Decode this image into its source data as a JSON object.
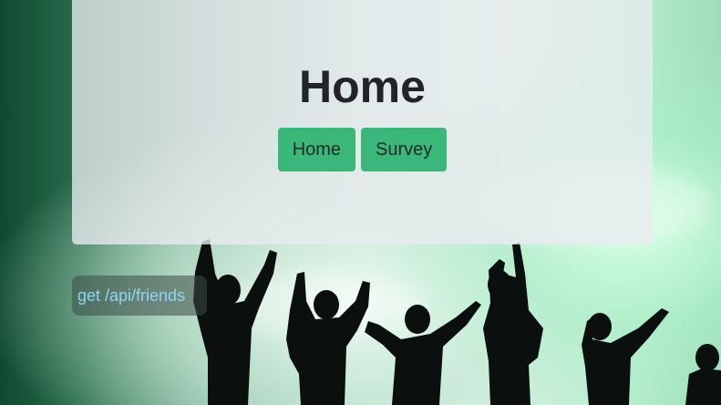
{
  "jumbotron": {
    "title": "Home"
  },
  "nav": {
    "home_label": "Home",
    "survey_label": "Survey"
  },
  "api_label": "get /api/friends",
  "colors": {
    "button_bg": "#3ab879",
    "button_text": "#1e2a24",
    "title_text": "#212529",
    "api_text": "#8fd6f2"
  }
}
